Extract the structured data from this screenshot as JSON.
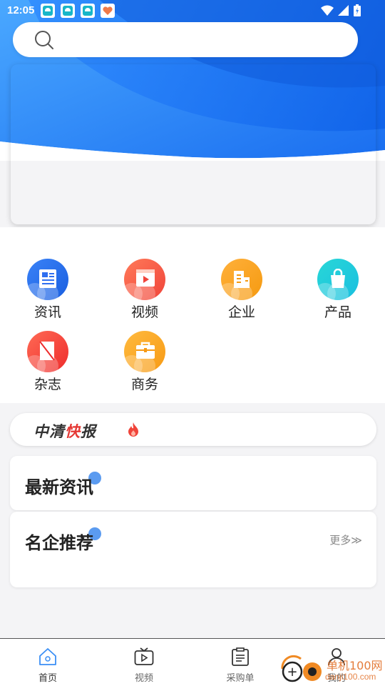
{
  "status_bar": {
    "time": "12:05"
  },
  "search": {
    "placeholder": ""
  },
  "menu": [
    {
      "label": "资讯",
      "icon": "news-icon",
      "color_from": "#3a82f7",
      "color_to": "#1a5fe0"
    },
    {
      "label": "视频",
      "icon": "video-icon",
      "color_from": "#ff7a59",
      "color_to": "#f0443a"
    },
    {
      "label": "企业",
      "icon": "enterprise-icon",
      "color_from": "#ffb03b",
      "color_to": "#f59a10"
    },
    {
      "label": "产品",
      "icon": "product-icon",
      "color_from": "#28d7d7",
      "color_to": "#1abfe0"
    },
    {
      "label": "杂志",
      "icon": "magazine-icon",
      "color_from": "#ff6a55",
      "color_to": "#ee2c2c"
    },
    {
      "label": "商务",
      "icon": "business-icon",
      "color_from": "#ffba3f",
      "color_to": "#f79a14"
    }
  ],
  "kuaibao": {
    "part1": "中清",
    "part2": "快",
    "part3": "报"
  },
  "latest_news": {
    "title": "最新资讯"
  },
  "featured_companies": {
    "title": "名企推荐",
    "more": "更多≫"
  },
  "tabs": [
    {
      "label": "首页",
      "icon": "home-icon",
      "active": true
    },
    {
      "label": "视频",
      "icon": "tv-icon",
      "active": false
    },
    {
      "label": "采购单",
      "icon": "clipboard-icon",
      "active": false
    },
    {
      "label": "我的",
      "icon": "user-icon",
      "active": false
    }
  ],
  "watermark": {
    "site": "单机100网",
    "url": "danji100.com"
  },
  "colors": {
    "accent_blue": "#2f80f2",
    "kuaibao_red": "#e53935"
  }
}
